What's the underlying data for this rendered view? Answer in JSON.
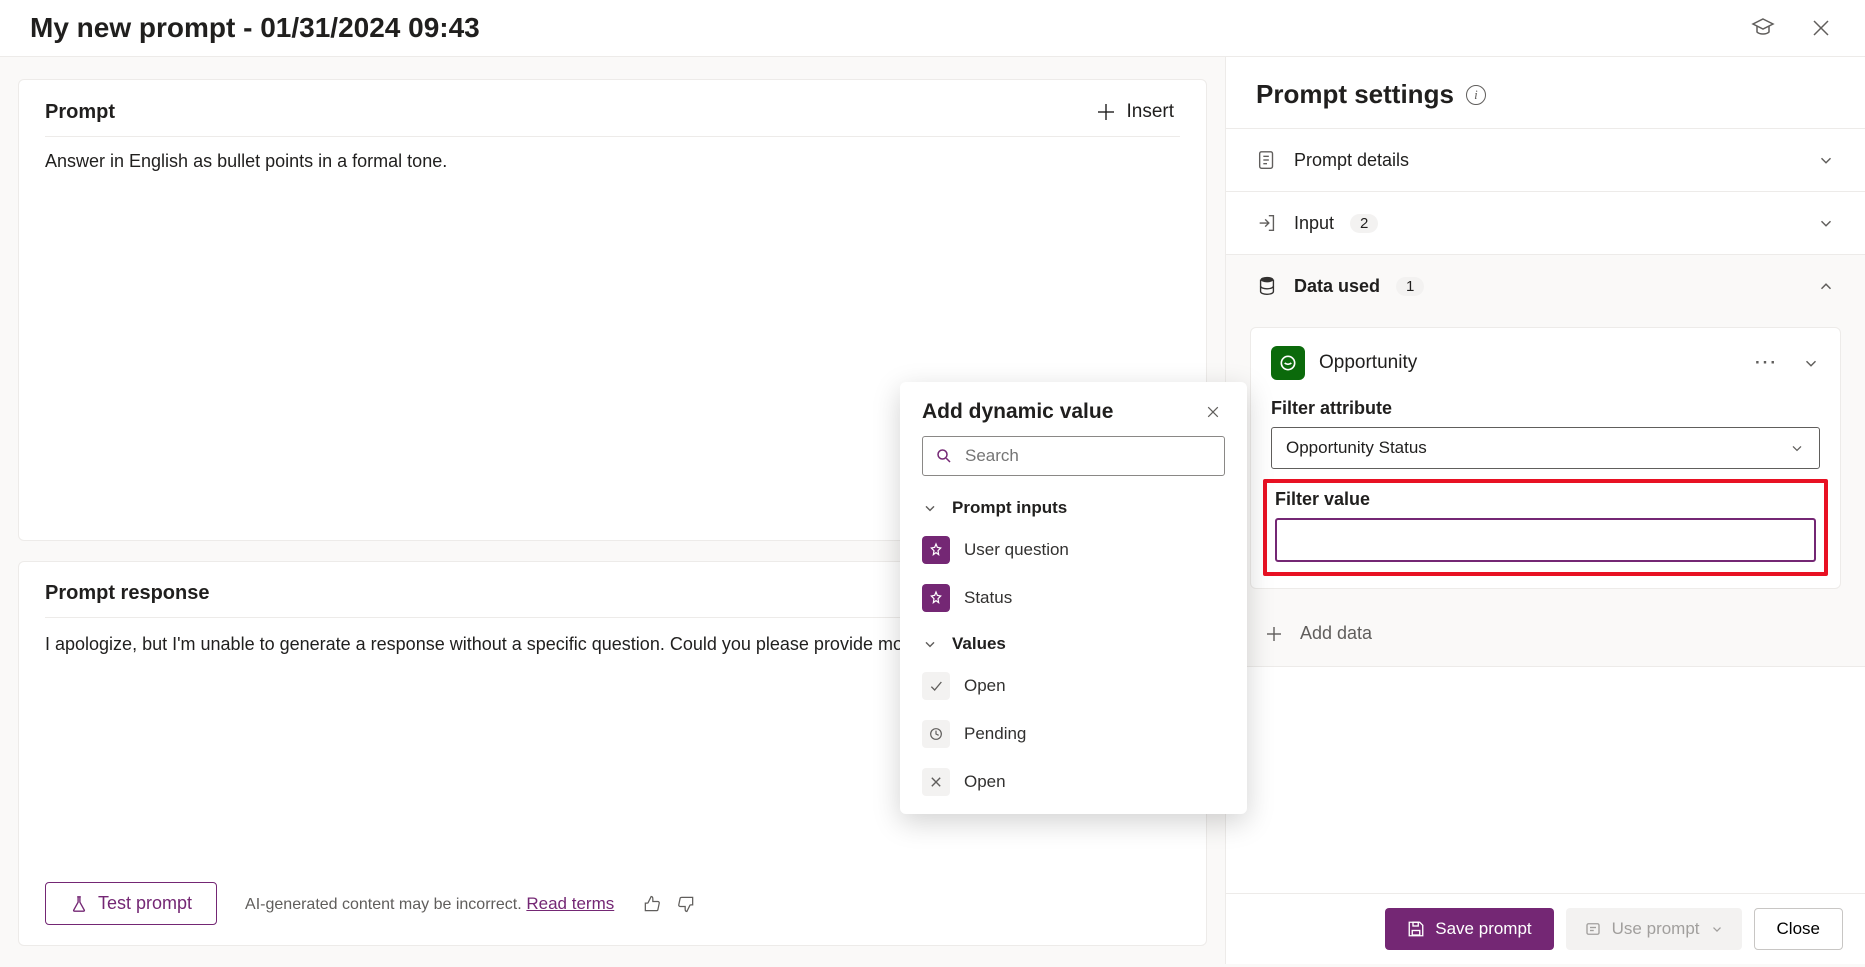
{
  "header": {
    "title": "My new prompt - 01/31/2024 09:43"
  },
  "prompt_card": {
    "title": "Prompt",
    "insert_label": "Insert",
    "body": "Answer in English as bullet points in a formal tone."
  },
  "response_card": {
    "title": "Prompt response",
    "body": "I apologize, but I'm unable to generate a response without a specific question. Could you please provide more de",
    "test_button": "Test prompt",
    "disclaimer": "AI-generated content may be incorrect.",
    "read_terms": "Read terms"
  },
  "settings": {
    "title": "Prompt settings",
    "rows": {
      "details": "Prompt details",
      "input": "Input",
      "input_count": "2",
      "data_used": "Data used",
      "data_used_count": "1"
    },
    "opportunity": {
      "label": "Opportunity",
      "filter_attribute_label": "Filter attribute",
      "filter_attribute_value": "Opportunity Status",
      "filter_value_label": "Filter value",
      "filter_value": ""
    },
    "add_data": "Add data"
  },
  "footer": {
    "save": "Save prompt",
    "use": "Use prompt",
    "close": "Close"
  },
  "popup": {
    "title": "Add dynamic value",
    "search_placeholder": "Search",
    "section_inputs": "Prompt inputs",
    "inputs": [
      {
        "label": "User question"
      },
      {
        "label": "Status"
      }
    ],
    "section_values": "Values",
    "values": [
      {
        "label": "Open",
        "icon": "check"
      },
      {
        "label": "Pending",
        "icon": "clock"
      },
      {
        "label": "Open",
        "icon": "x"
      }
    ]
  }
}
